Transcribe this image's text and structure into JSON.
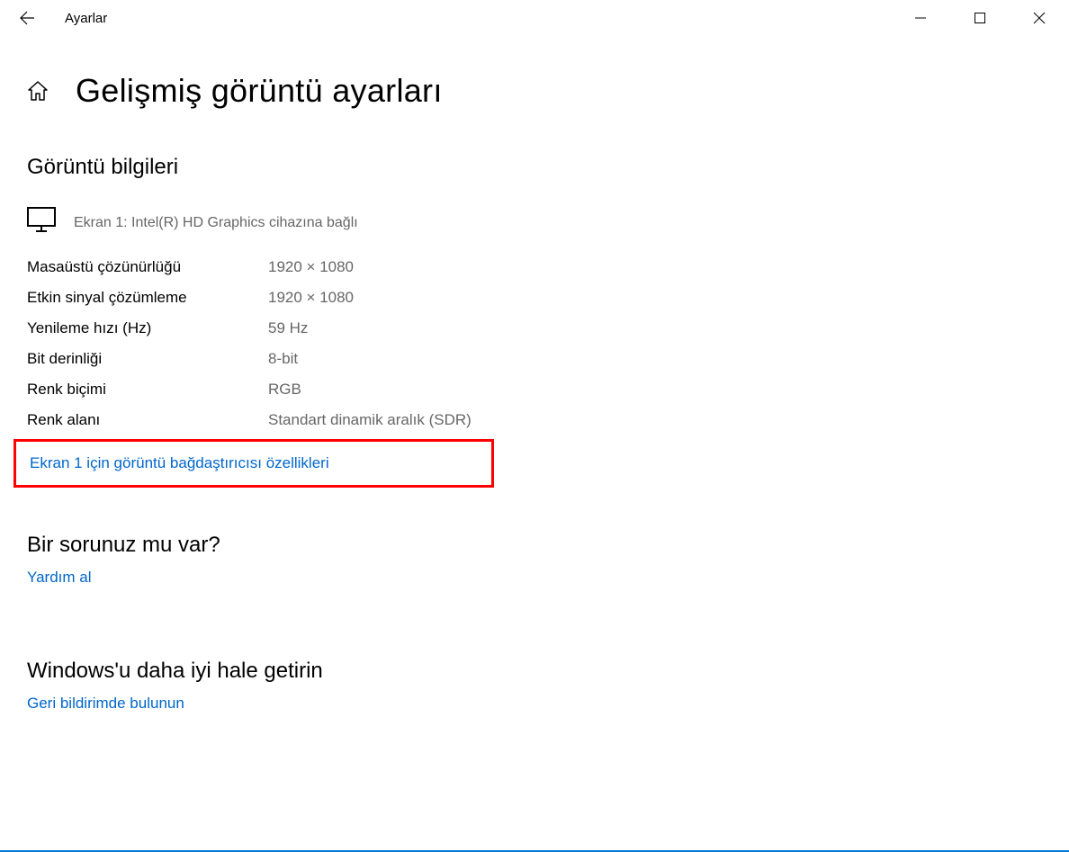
{
  "app_title": "Ayarlar",
  "page_title": "Gelişmiş görüntü ayarları",
  "sections": {
    "display_info": {
      "title": "Görüntü bilgileri",
      "display_desc": "Ekran 1: Intel(R) HD Graphics cihazına bağlı",
      "rows": [
        {
          "label": "Masaüstü çözünürlüğü",
          "value": "1920 × 1080"
        },
        {
          "label": "Etkin sinyal çözümleme",
          "value": "1920 × 1080"
        },
        {
          "label": "Yenileme hızı (Hz)",
          "value": "59 Hz"
        },
        {
          "label": "Bit derinliği",
          "value": "8-bit"
        },
        {
          "label": "Renk biçimi",
          "value": "RGB"
        },
        {
          "label": "Renk alanı",
          "value": "Standart dinamik aralık (SDR)"
        }
      ],
      "adapter_link": "Ekran 1 için görüntü bağdaştırıcısı özellikleri"
    },
    "question": {
      "title": "Bir sorunuz mu var?",
      "link": "Yardım al"
    },
    "feedback": {
      "title": "Windows'u daha iyi hale getirin",
      "link": "Geri bildirimde bulunun"
    }
  }
}
